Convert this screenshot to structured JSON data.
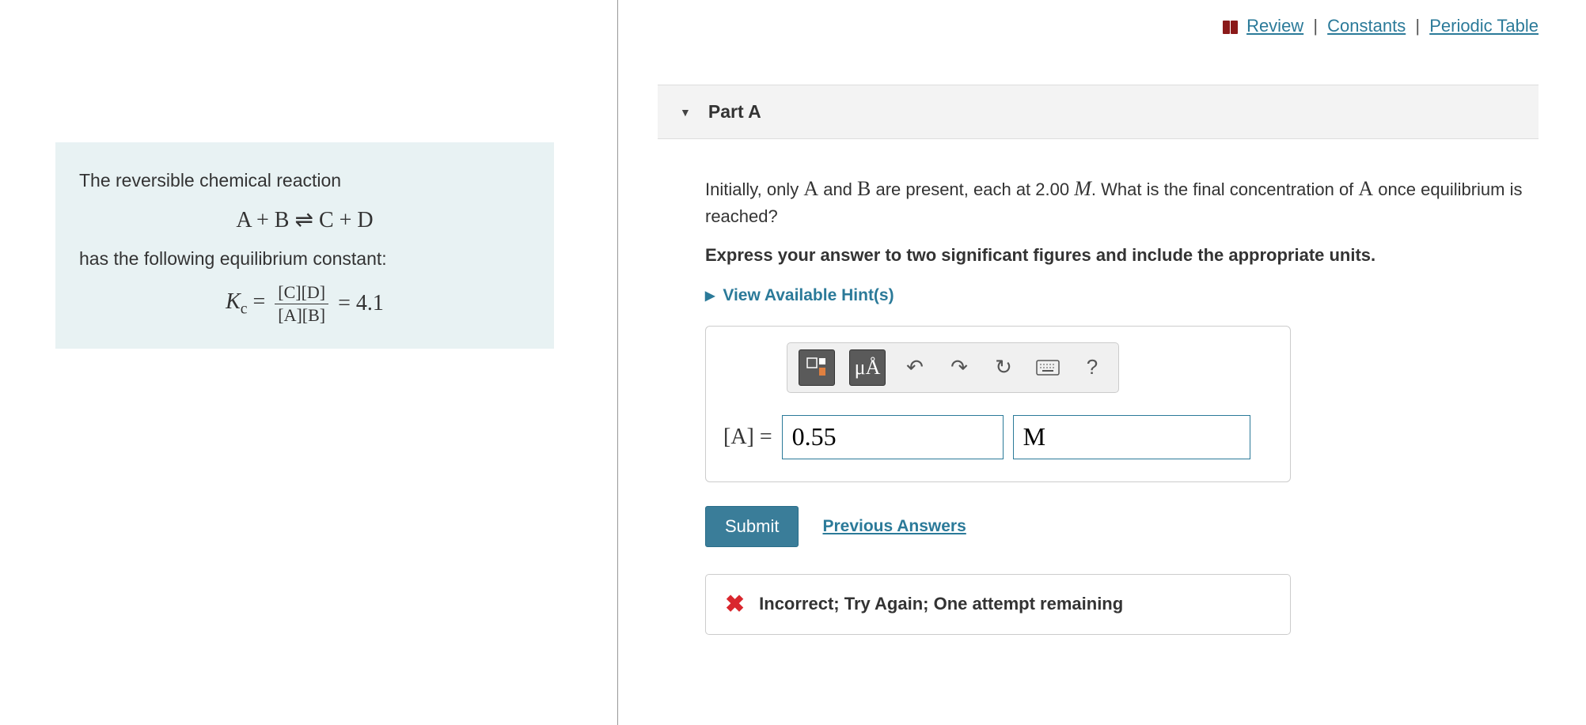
{
  "top_links": {
    "review": "Review",
    "constants": "Constants",
    "periodic": "Periodic Table"
  },
  "info": {
    "intro": "The reversible chemical reaction",
    "equation_left": "A + B",
    "equation_right": "C + D",
    "has_text": "has the following equilibrium constant:",
    "kc_label": "K",
    "kc_sub": "c",
    "kc_num": "[C][D]",
    "kc_den": "[A][B]",
    "kc_val": "4.1"
  },
  "part": {
    "title": "Part A"
  },
  "question": {
    "line1_a": "Initially, only ",
    "line1_b": " and ",
    "line1_c": " are present, each at 2.00 ",
    "line1_d": ". What is the final concentration of ",
    "line1_e": " once equilibrium is reached?",
    "var_A": "A",
    "var_B": "B",
    "var_M": "M",
    "instr": "Express your answer to two significant figures and include the appropriate units."
  },
  "hints": {
    "label": "View Available Hint(s)"
  },
  "toolbar": {
    "units_btn": "μÅ",
    "help": "?"
  },
  "answer": {
    "label": "[A] = ",
    "value": "0.55",
    "unit": "M"
  },
  "submit": {
    "btn": "Submit",
    "prev": "Previous Answers"
  },
  "feedback": {
    "msg": "Incorrect; Try Again; One attempt remaining"
  }
}
